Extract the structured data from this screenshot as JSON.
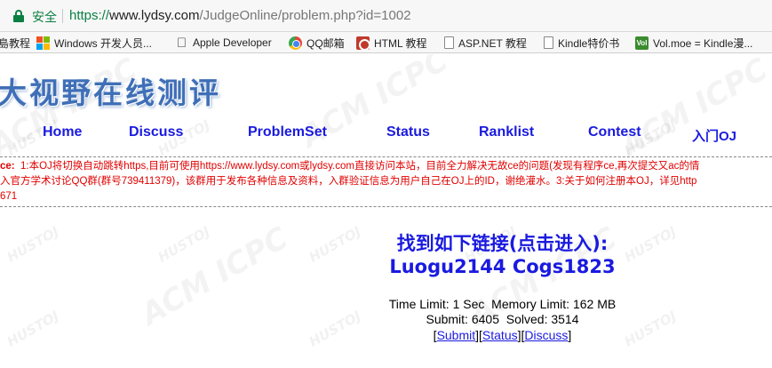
{
  "browser": {
    "secure_label": "安全",
    "url_scheme": "https://",
    "url_host": "www.lydsy.com",
    "url_path": "/JudgeOnline/problem.php?id=1002",
    "colors": {
      "secure": "#0b8043"
    }
  },
  "bookmarks": [
    {
      "label": "島教程",
      "icon": "none"
    },
    {
      "label": "Windows 开发人员...",
      "icon": "windows-icon"
    },
    {
      "label": "Apple Developer",
      "icon": "apple-icon"
    },
    {
      "label": "QQ邮箱",
      "icon": "qq-mail-icon"
    },
    {
      "label": "HTML 教程",
      "icon": "html-tutorial-icon"
    },
    {
      "label": "ASP.NET 教程",
      "icon": "document-icon"
    },
    {
      "label": "Kindle特价书",
      "icon": "document-icon"
    },
    {
      "label": "Vol.moe = Kindle漫...",
      "icon": "vol-icon",
      "icon_text": "Vol"
    }
  ],
  "site": {
    "logo_text": "大视野在线测评",
    "nav": [
      "Home",
      "Discuss",
      "ProblemSet",
      "Status",
      "Ranklist",
      "Contest",
      "入门OJ"
    ],
    "colors": {
      "link": "#1a1ae0",
      "notice": "#e00000",
      "logo": "#3f6fb7"
    }
  },
  "notice": {
    "line1_label": "ce:",
    "line1": "1:本OJ将切换自动跳转https,目前可使用https://www.lydsy.com或lydsy.com直接访问本站，目前全力解决无故ce的问题(发现有程序ce,再次提交又ac的情",
    "line2": "入官方学术讨论QQ群(群号739411379)，该群用于发布各种信息及资料，入群验证信息为用户自己在OJ上的ID，谢绝灌水。3:关于如何注册本OJ，详见http",
    "line3": "671"
  },
  "problem": {
    "title_line1": "找到如下链接(点击进入):",
    "title_line2": "Luogu2144 Cogs1823",
    "time_limit": "Time Limit: 1 Sec",
    "memory_limit": "Memory Limit: 162 MB",
    "submit": "Submit: 6405",
    "solved": "Solved: 3514",
    "links": [
      "Submit",
      "Status",
      "Discuss"
    ]
  },
  "watermark": {
    "big": "ACM  ICPC",
    "small": "HUSTOJ"
  }
}
